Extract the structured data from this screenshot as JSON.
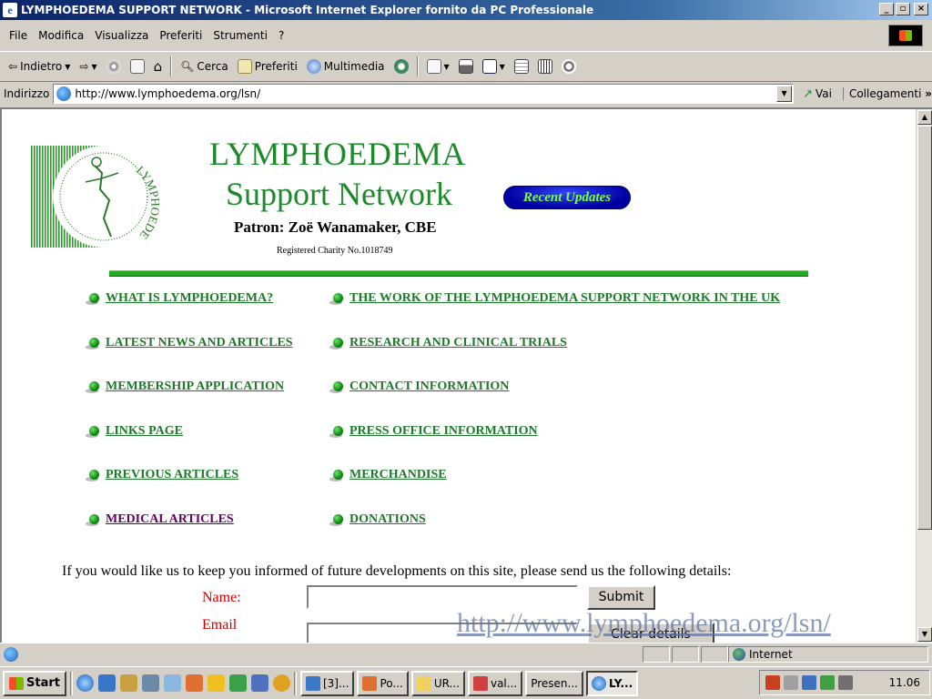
{
  "window": {
    "title": "LYMPHOEDEMA SUPPORT NETWORK - Microsoft Internet Explorer fornito da PC Professionale",
    "buttons": {
      "minimize": "_",
      "maximize": "▫",
      "close": "×"
    }
  },
  "menu": [
    "File",
    "Modifica",
    "Visualizza",
    "Preferiti",
    "Strumenti",
    "?"
  ],
  "toolbar": {
    "back": "Indietro",
    "search": "Cerca",
    "favorites": "Preferiti",
    "media": "Multimedia"
  },
  "address": {
    "label": "Indirizzo",
    "url": "http://www.lymphoedema.org/lsn/",
    "go": "Vai",
    "links": "Collegamenti"
  },
  "page": {
    "title": "LYMPHOEDEMA",
    "subtitle": "Support Network",
    "updates_button": "Recent Updates",
    "patron": "Patron: Zoë Wanamaker, CBE",
    "charity": "Registered Charity No.1018749",
    "logo_letters": "LYMPHOEDEMA",
    "links_left": [
      "WHAT IS LYMPHOEDEMA?",
      "LATEST NEWS AND ARTICLES",
      "MEMBERSHIP APPLICATION",
      "LINKS PAGE",
      "PREVIOUS ARTICLES",
      "MEDICAL ARTICLES"
    ],
    "links_right": [
      "THE WORK OF THE LYMPHOEDEMA SUPPORT NETWORK IN THE UK",
      "RESEARCH AND CLINICAL TRIALS",
      "CONTACT INFORMATION",
      "PRESS OFFICE INFORMATION",
      "MERCHANDISE",
      "DONATIONS"
    ],
    "inform_text": "If you would like us to keep you informed of future developments on this site, please send us the following details:",
    "form": {
      "name_label": "Name:",
      "email_label": "Email",
      "submit": "Submit",
      "clear": "Clear details"
    },
    "watermark": "http://www.lymphoedema.org/lsn/"
  },
  "status": {
    "zone": "Internet"
  },
  "taskbar": {
    "start": "Start",
    "tasks": [
      "[3]...",
      "Po...",
      "UR...",
      "val...",
      "Presen...",
      "LY..."
    ],
    "clock": "11.06"
  },
  "colors": {
    "brand_green": "#1d8a2a",
    "link_visited": "#660066",
    "label_red": "#cc0000"
  }
}
